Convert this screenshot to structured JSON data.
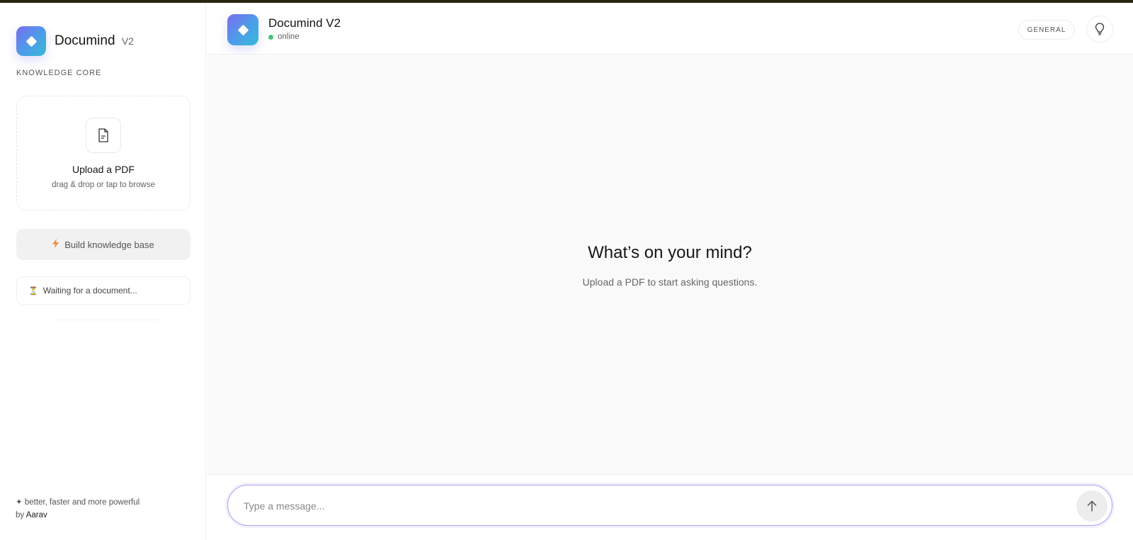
{
  "app": {
    "name": "Documind",
    "version": "V2"
  },
  "sidebar": {
    "section_label": "KNOWLEDGE CORE",
    "upload": {
      "title": "Upload a PDF",
      "subtitle": "drag & drop or tap to browse",
      "icon": "document-icon"
    },
    "build_button": {
      "label": "Build knowledge base",
      "icon": "bolt-icon"
    },
    "status": {
      "text": "Waiting for a document...",
      "icon": "hourglass-icon"
    },
    "footer": {
      "tagline": "✦ better, faster and more powerful",
      "by_prefix": "by",
      "author": "Aarav"
    }
  },
  "header": {
    "title": "Documind V2",
    "status": "online",
    "mode": "GENERAL",
    "idea_icon": "lightbulb-icon"
  },
  "main": {
    "heading": "What’s on your mind?",
    "subheading": "Upload a PDF to start asking questions."
  },
  "composer": {
    "placeholder": "Type a message...",
    "send_icon": "arrow-up-icon"
  },
  "colors": {
    "accent_start": "#7b6cf0",
    "accent_end": "#39b9d6",
    "online": "#46c37b",
    "bolt": "#f08a3a",
    "composer_border": "#a9a0f2"
  }
}
